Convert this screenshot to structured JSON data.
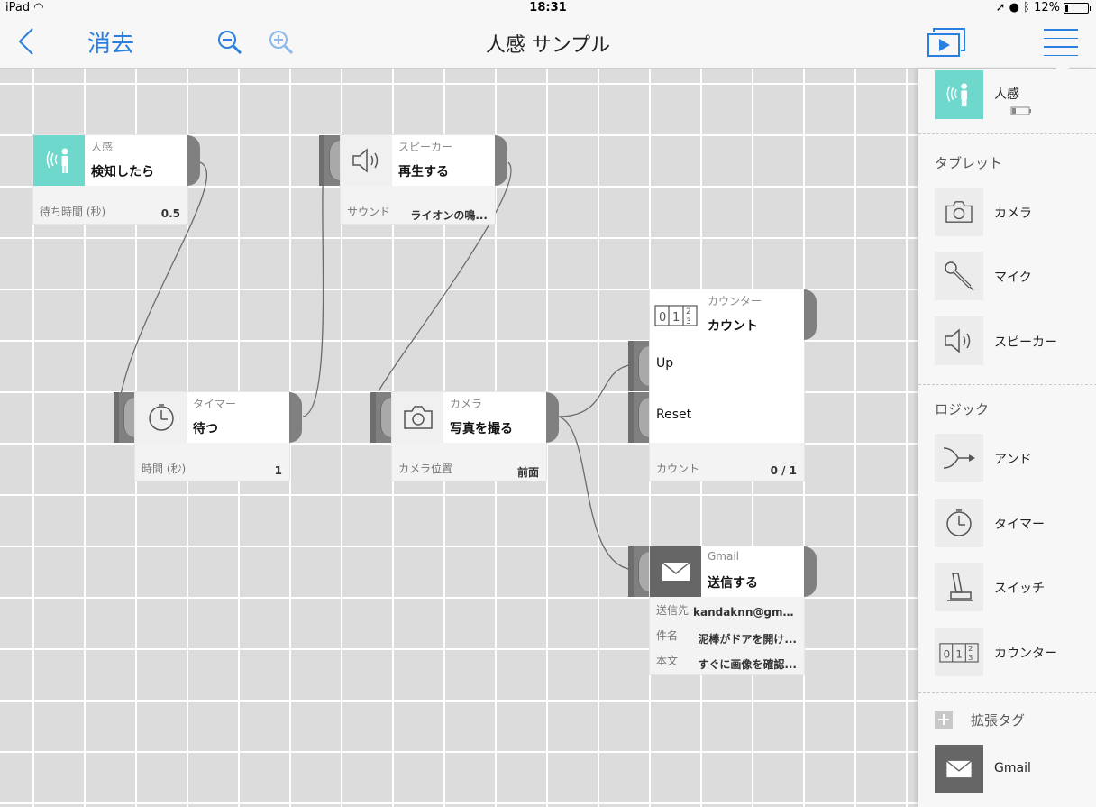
{
  "status": {
    "device": "iPad",
    "time": "18:31",
    "battery": "12%"
  },
  "nav": {
    "back_label": "<",
    "clear_label": "消去",
    "title": "人感 サンプル"
  },
  "blocks": {
    "motion": {
      "category": "人感",
      "action": "検知したら",
      "param_label": "待ち時間 (秒)",
      "param_value": "0.5"
    },
    "speaker": {
      "category": "スピーカー",
      "action": "再生する",
      "param_label": "サウンド",
      "param_value": "ライオンの鳴..."
    },
    "timer": {
      "category": "タイマー",
      "action": "待つ",
      "param_label": "時間 (秒)",
      "param_value": "1"
    },
    "camera": {
      "category": "カメラ",
      "action": "写真を撮る",
      "param_label": "カメラ位置",
      "param_value": "前面"
    },
    "counter": {
      "category": "カウンター",
      "action": "カウント",
      "input_up": "Up",
      "input_reset": "Reset",
      "param_label": "カウント",
      "param_value": "0 / 1"
    },
    "gmail": {
      "category": "Gmail",
      "action": "送信する",
      "to_label": "送信先",
      "to_value": "kandaknn@gma...",
      "subject_label": "件名",
      "subject_value": "泥棒がドアを開け...",
      "body_label": "本文",
      "body_value": "すぐに画像を確認..."
    }
  },
  "panel": {
    "device_label": "人感",
    "tablet_section": "タブレット",
    "tablet_items": [
      "カメラ",
      "マイク",
      "スピーカー"
    ],
    "logic_section": "ロジック",
    "logic_items": [
      "アンド",
      "タイマー",
      "スイッチ",
      "カウンター"
    ],
    "ext_section": "拡張タグ",
    "ext_items": [
      "Gmail"
    ]
  },
  "colors": {
    "accent": "#2a7fe0",
    "motion_teal": "#6fd8cd",
    "port_gray": "#808080"
  }
}
